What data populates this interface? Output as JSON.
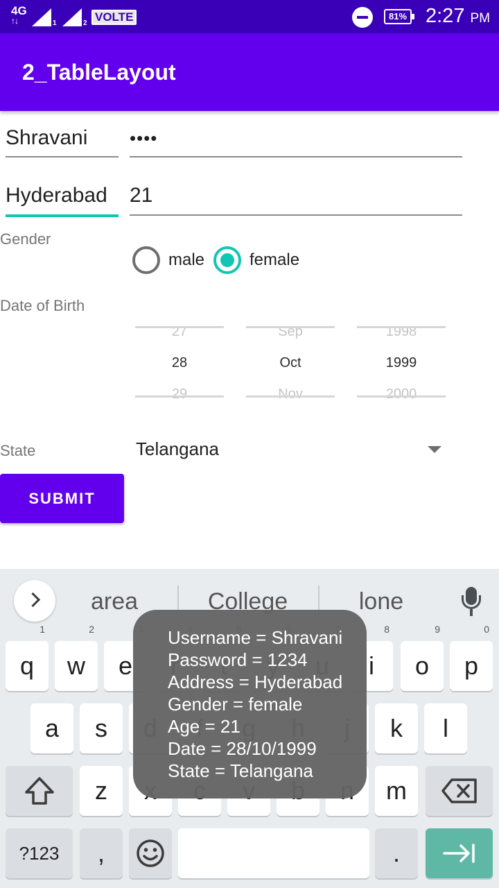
{
  "status_bar": {
    "network": "4G",
    "sim1": "1",
    "sim2": "2",
    "volte": "VOLTE",
    "battery": "81%",
    "time": "2:27",
    "ampm": "PM"
  },
  "app_bar": {
    "title": "2_TableLayout"
  },
  "form": {
    "username": "Shravani",
    "password_mask": "••••",
    "address": "Hyderabad",
    "age": "21",
    "gender_label": "Gender",
    "gender_options": [
      "male",
      "female"
    ],
    "gender_selected": "female",
    "dob_label": "Date of Birth",
    "date_picker": {
      "day": {
        "prev": "27",
        "current": "28",
        "next": "29"
      },
      "month": {
        "prev": "Sep",
        "current": "Oct",
        "next": "Nov"
      },
      "year": {
        "prev": "1998",
        "current": "1999",
        "next": "2000"
      }
    },
    "state_label": "State",
    "state_value": "Telangana",
    "submit_label": "SUBMIT"
  },
  "keyboard": {
    "suggestions": [
      "area",
      "College",
      "lone"
    ],
    "row1": [
      {
        "k": "q",
        "h": "1"
      },
      {
        "k": "w",
        "h": "2"
      },
      {
        "k": "e",
        "h": "3"
      },
      {
        "k": "r",
        "h": "4"
      },
      {
        "k": "t",
        "h": "5"
      },
      {
        "k": "y",
        "h": "6"
      },
      {
        "k": "u",
        "h": "7"
      },
      {
        "k": "i",
        "h": "8"
      },
      {
        "k": "o",
        "h": "9"
      },
      {
        "k": "p",
        "h": "0"
      }
    ],
    "row2": [
      "a",
      "s",
      "d",
      "f",
      "g",
      "h",
      "j",
      "k",
      "l"
    ],
    "row3": [
      "z",
      "x",
      "c",
      "v",
      "b",
      "n",
      "m"
    ],
    "symbols_label": "?123",
    "comma": ",",
    "period": "."
  },
  "toast": {
    "lines": [
      "Username = Shravani",
      "Password = 1234",
      "Address = Hyderabad",
      "Gender = female",
      "Age = 21",
      "Date = 28/10/1999",
      "State = Telangana"
    ]
  },
  "colors": {
    "status_bar": "#3a00b8",
    "app_bar": "#6200ee",
    "accent": "#11c7b4",
    "enter_key": "#5fb8a6"
  }
}
